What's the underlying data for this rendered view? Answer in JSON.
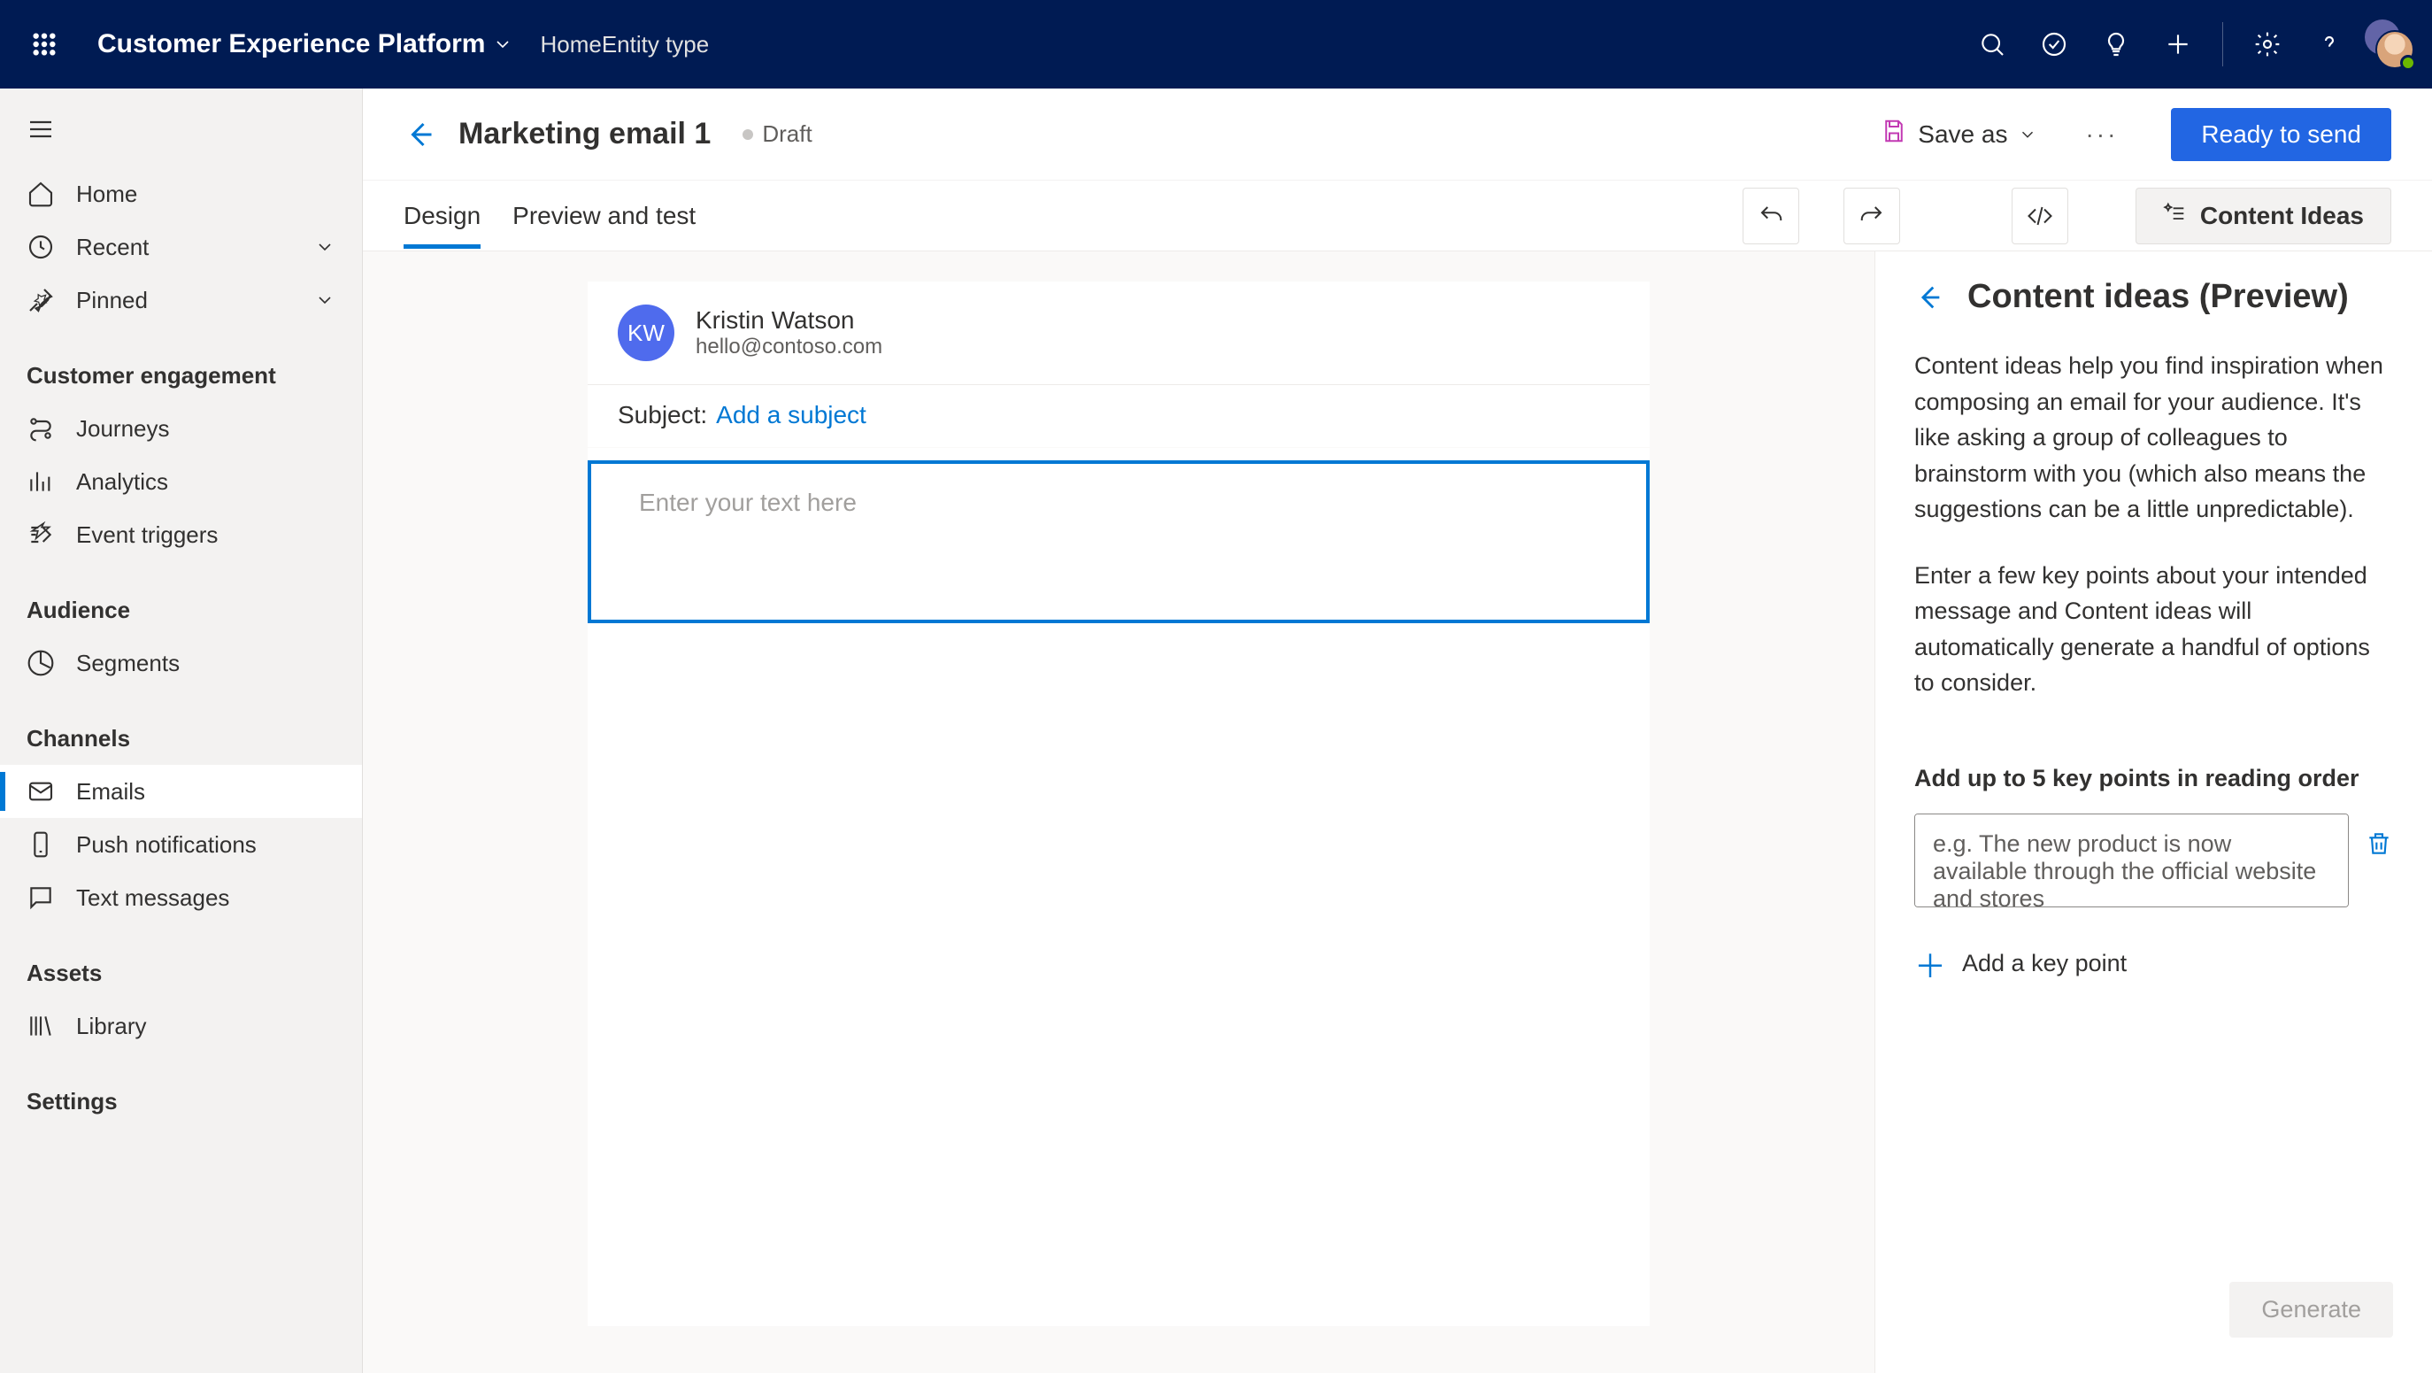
{
  "topbar": {
    "app_title": "Customer Experience Platform",
    "breadcrumb": "HomeEntity type"
  },
  "sidebar": {
    "home": "Home",
    "recent": "Recent",
    "pinned": "Pinned",
    "section_engagement": "Customer engagement",
    "journeys": "Journeys",
    "analytics": "Analytics",
    "event_triggers": "Event triggers",
    "section_audience": "Audience",
    "segments": "Segments",
    "section_channels": "Channels",
    "emails": "Emails",
    "push": "Push notifications",
    "text_msgs": "Text messages",
    "section_assets": "Assets",
    "library": "Library",
    "section_settings": "Settings"
  },
  "page": {
    "title": "Marketing email 1",
    "status": "Draft",
    "save_as": "Save as",
    "ready_to_send": "Ready to send"
  },
  "tabs": {
    "design": "Design",
    "preview": "Preview and test",
    "content_ideas_btn": "Content Ideas"
  },
  "email": {
    "sender_initials": "KW",
    "sender_name": "Kristin Watson",
    "sender_email": "hello@contoso.com",
    "subject_label": "Subject:",
    "subject_link": "Add a subject",
    "editor_placeholder": "Enter your text here"
  },
  "panel": {
    "title": "Content ideas (Preview)",
    "desc1": "Content ideas help you find inspiration when composing an email for your audience. It's like asking a group of colleagues to brainstorm with you (which also means the suggestions can be a little unpredictable).",
    "desc2": "Enter a few key points about your intended message and Content ideas will automatically generate a handful of options to consider.",
    "key_points_label": "Add up to 5 key points in reading order",
    "key_input_placeholder": "e.g. The new product is now available through the official website and stores",
    "add_key_point": "Add a key point",
    "generate": "Generate"
  }
}
